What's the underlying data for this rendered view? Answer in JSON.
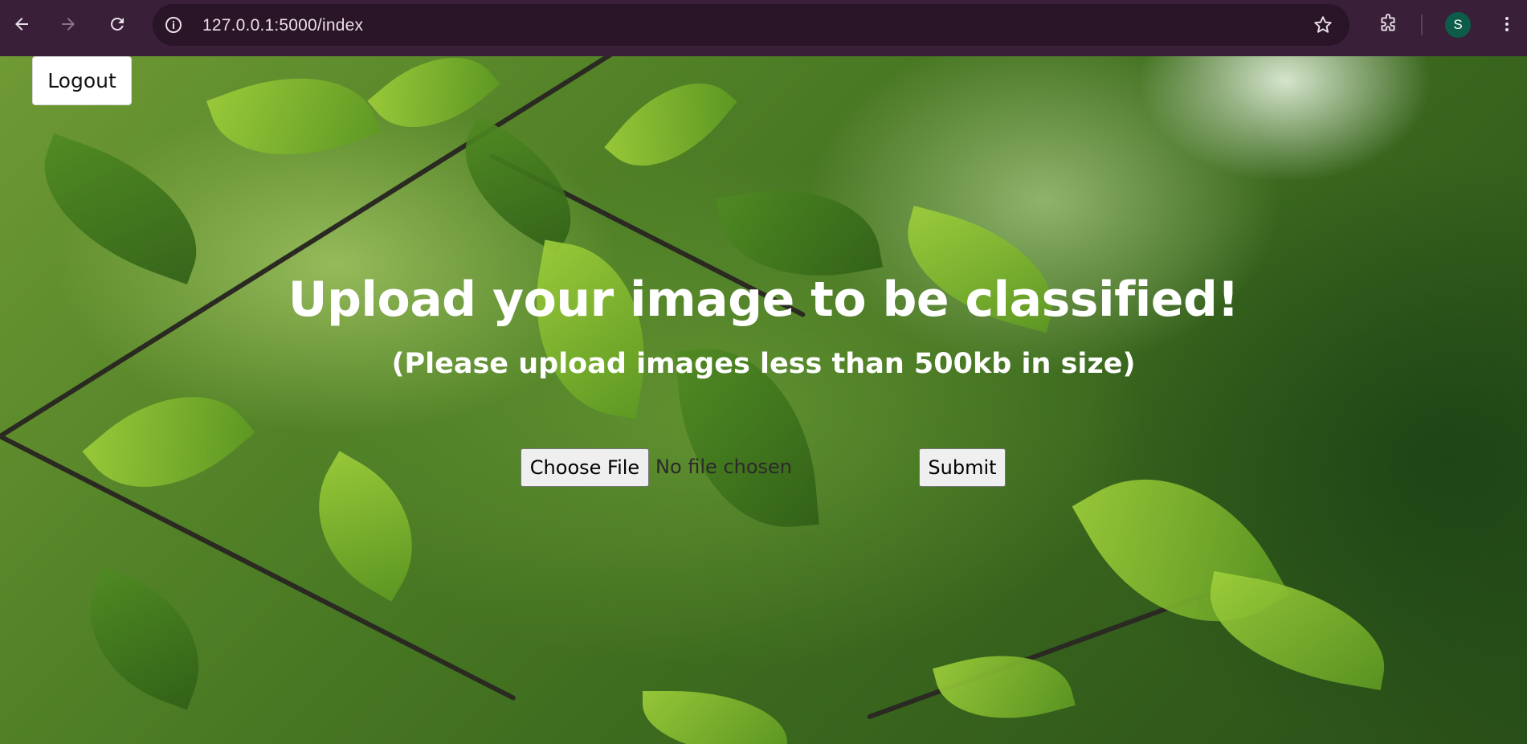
{
  "browser": {
    "url": "127.0.0.1:5000/index",
    "profile_initial": "S",
    "profile_color": "#0d5c4a",
    "icons": {
      "back": "back-arrow-icon",
      "forward": "forward-arrow-icon",
      "reload": "reload-icon",
      "site_info": "info-icon",
      "bookmark": "star-icon",
      "extensions": "puzzle-icon",
      "menu": "kebab-menu-icon"
    }
  },
  "page": {
    "logout_label": "Logout",
    "title": "Upload your image to be classified!",
    "subtitle": "(Please upload images less than 500kb in size)",
    "upload": {
      "choose_file_label": "Choose File",
      "file_status": "No file chosen",
      "submit_label": "Submit"
    }
  }
}
